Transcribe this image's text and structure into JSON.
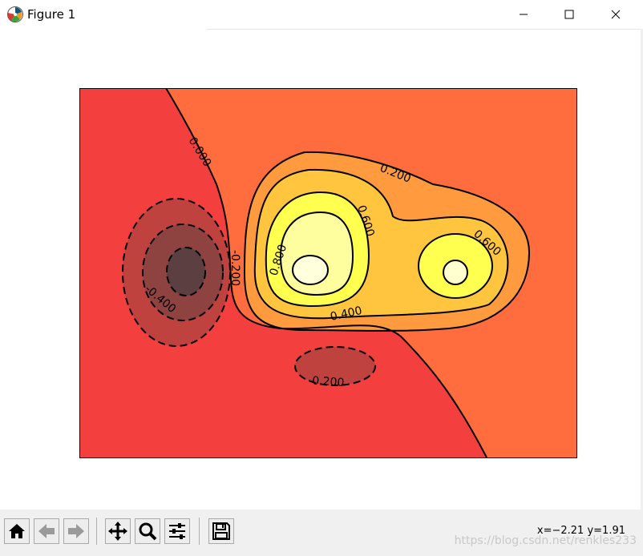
{
  "window": {
    "title": "Figure 1",
    "buttons": {
      "minimize": "minimize",
      "maximize": "maximize",
      "close": "close"
    }
  },
  "toolbar": {
    "buttons": [
      {
        "name": "home",
        "icon": "home-icon"
      },
      {
        "name": "back",
        "icon": "arrow-left-icon"
      },
      {
        "name": "forward",
        "icon": "arrow-right-icon"
      },
      {
        "name": "pan",
        "icon": "move-icon"
      },
      {
        "name": "zoom",
        "icon": "magnifier-icon"
      },
      {
        "name": "configure-subplots",
        "icon": "sliders-icon"
      },
      {
        "name": "save",
        "icon": "floppy-disk-icon"
      }
    ],
    "coordinates": "x=−2.21 y=1.91",
    "watermark": "https://blog.csdn.net/renkles233"
  },
  "chart_data": {
    "type": "contour",
    "filled": true,
    "colormap": "hot",
    "title": "",
    "xlabel": "",
    "ylabel": "",
    "axes_ticks_visible": false,
    "contour_levels": [
      -0.4,
      -0.2,
      0.0,
      0.2,
      0.4,
      0.6,
      0.8
    ],
    "contour_labels": [
      {
        "text": "0.000"
      },
      {
        "text": "0.200"
      },
      {
        "text": "0.600"
      },
      {
        "text": "0.800"
      },
      {
        "text": "0.600"
      },
      {
        "text": "0.400"
      },
      {
        "text": "-0.200"
      },
      {
        "text": "-0.400"
      },
      {
        "text": "-0.200"
      }
    ],
    "negative_linestyle": "dashed",
    "colors": {
      "background_level": "#f43f3f",
      "level_0_to_0.2": "#ff6c3e",
      "level_0.2_to_0.4": "#ff9a3e",
      "level_0.4_to_0.6": "#ffc53e",
      "level_0.6_to_0.8": "#ffff4f",
      "level_0.8_plus": "#ffffd9",
      "level_-0.2_to_-0.4": "#c0423f",
      "level_-0.4_to_-0.6": "#8f4341",
      "level_below_-0.6": "#5c4041"
    }
  }
}
